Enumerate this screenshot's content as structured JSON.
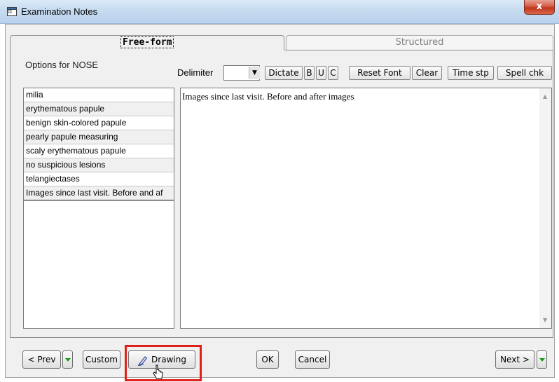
{
  "window": {
    "title": "Examination Notes",
    "close_label": "x"
  },
  "tabs": [
    {
      "label": "Free-form",
      "active": true
    },
    {
      "label": "Structured",
      "active": false
    }
  ],
  "options_label": "Options for NOSE",
  "toolbar": {
    "delimiter_label": "Delimiter",
    "delimiter_value": "",
    "dictate": "Dictate",
    "bold": "B",
    "underline": "U",
    "c": "C",
    "reset_font": "Reset Font",
    "clear": "Clear",
    "time_stp": "Time stp",
    "spell_chk": "Spell chk"
  },
  "options": [
    "milia",
    "erythematous papule",
    "benign skin-colored papule",
    "pearly papule measuring",
    "scaly erythematous papule",
    "no suspicious lesions",
    "telangiectases",
    "Images since last visit. Before and af"
  ],
  "notes_text": "Images since last visit. Before and after images",
  "buttons": {
    "prev": "< Prev",
    "custom": "Custom",
    "drawing": "Drawing",
    "ok": "OK",
    "cancel": "Cancel",
    "next": "Next >"
  },
  "colors": {
    "highlight": "#e0201a",
    "arrow_green": "#1a9a1a"
  },
  "icons": [
    "window-icon",
    "pencil-icon",
    "mouse-cursor-icon",
    "scroll-up-icon",
    "scroll-down-icon"
  ]
}
